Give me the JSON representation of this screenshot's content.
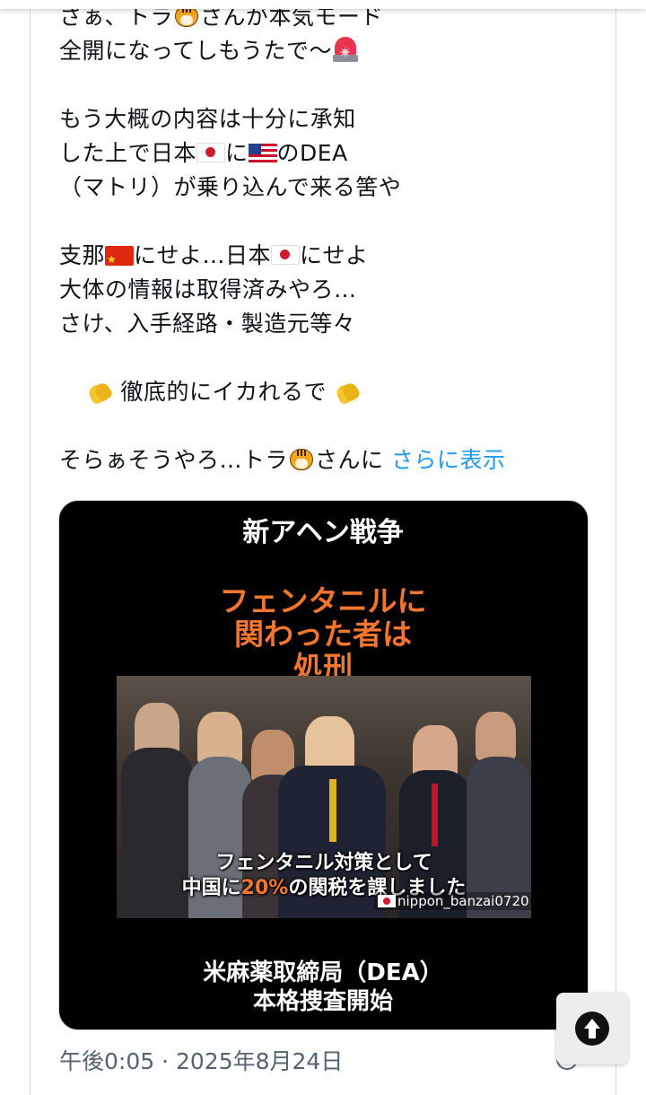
{
  "post": {
    "lines": [
      {
        "a": "さぁ、トラ",
        "b": "さんが本気モード"
      },
      {
        "a": "全開になってしもうたで〜"
      },
      {
        "a": "もう大概の内容は十分に承知"
      },
      {
        "a": "した上で日本",
        "b": "に",
        "c": "のDEA"
      },
      {
        "a": "（マトリ）が乗り込んで来る筈や"
      },
      {
        "a": "支那",
        "b": "にせよ…日本",
        "c": "にせよ"
      },
      {
        "a": "大体の情報は取得済みやろ…"
      },
      {
        "a": "さけ、入手経路・製造元等々"
      },
      {
        "a": "徹底的にイカれるで"
      },
      {
        "a": "そらぁそうやろ…トラ",
        "b": "さんに "
      }
    ],
    "show_more": "さらに表示",
    "timestamp": "午後0:05 · 2025年8月24日"
  },
  "video": {
    "headline": "新アヘン戦争",
    "red_line1": "フェンタニルに",
    "red_line2": "関わった者は",
    "red_line3": "処刑",
    "caption_line1": "フェンタニル対策として",
    "caption_line2_pre": "中国に",
    "caption_line2_hl": "20%",
    "caption_line2_post": "の関税を課しました",
    "handle": "nippon_banzai0720",
    "bottom_line1": "米麻薬取締局（DEA）",
    "bottom_line2": "本格捜査開始"
  },
  "icons": {
    "tiger": "tiger-face-icon",
    "siren": "police-light-icon",
    "clap": "clapping-hands-icon",
    "scroll": "scroll-to-top-icon",
    "info": "info-icon"
  },
  "colors": {
    "link": "#1d9bf0",
    "meta_text": "#536471",
    "video_red": "#f2762e"
  }
}
